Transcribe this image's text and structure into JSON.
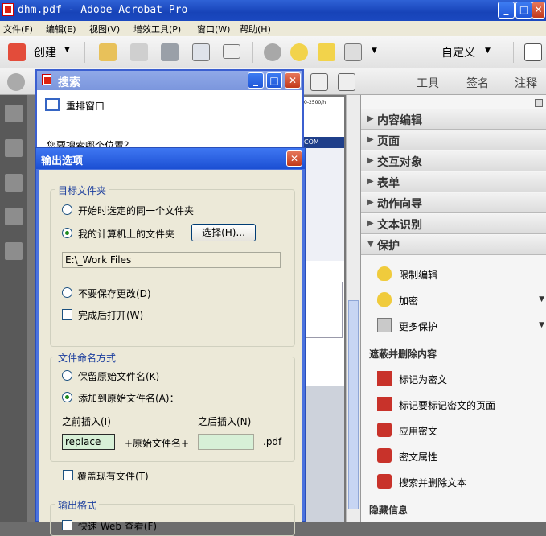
{
  "window": {
    "title": "dhm.pdf - Adobe Acrobat Pro"
  },
  "menubar": {
    "items": [
      "文件(F)",
      "编辑(E)",
      "视图(V)",
      "增效工具(P)",
      "窗口(W)",
      "帮助(H)"
    ]
  },
  "toolbar": {
    "create_label": "创建",
    "custom_label": "自定义"
  },
  "pane_tabs": {
    "tools": "工具",
    "sign": "签名",
    "comment": "注释"
  },
  "search_window": {
    "title": "搜索",
    "rearrange": "重排窗口",
    "question": "您要搜索哪个位置？"
  },
  "dialog": {
    "title": "输出选项",
    "target_folder": {
      "label": "目标文件夹",
      "opt_same": "开始时选定的同一个文件夹",
      "opt_mycomputer": "我的计算机上的文件夹",
      "choose_button": "选择(H)...",
      "path": "E:\\_Work Files",
      "opt_nosave": "不要保存更改(D)",
      "open_after": "完成后打开(W)"
    },
    "naming": {
      "label": "文件命名方式",
      "keep_original": "保留原始文件名(K)",
      "add_to_original": "添加到原始文件名(A)：",
      "insert_before_label": "之前插入(I)",
      "insert_after_label": "之后插入(N)",
      "insert_before_value": "replace",
      "plus_original": "+原始文件名+",
      "extension": ".pdf",
      "overwrite": "覆盖现有文件(T)"
    },
    "output_format": {
      "label": "输出格式",
      "fast_web": "快速 Web 查看(F)"
    }
  },
  "right_pane": {
    "sections": [
      "内容编辑",
      "页面",
      "交互对象",
      "表单",
      "动作向导",
      "文本识别",
      "保护"
    ],
    "protect_items": [
      "限制编辑",
      "加密",
      "更多保护"
    ],
    "redact_group": "遮蔽并删除内容",
    "redact_items": [
      "标记为密文",
      "标记要标记密文的页面",
      "应用密文",
      "密文属性",
      "搜索并删除文本"
    ],
    "hidden_group": "隐藏信息"
  },
  "doc_fragments": {
    "com": "COM",
    "label": "0-2500/h"
  },
  "colors": {
    "title_blue": "#1743b8",
    "dialog_bg": "#ece9d8",
    "accent_green": "#d7f0d7"
  }
}
